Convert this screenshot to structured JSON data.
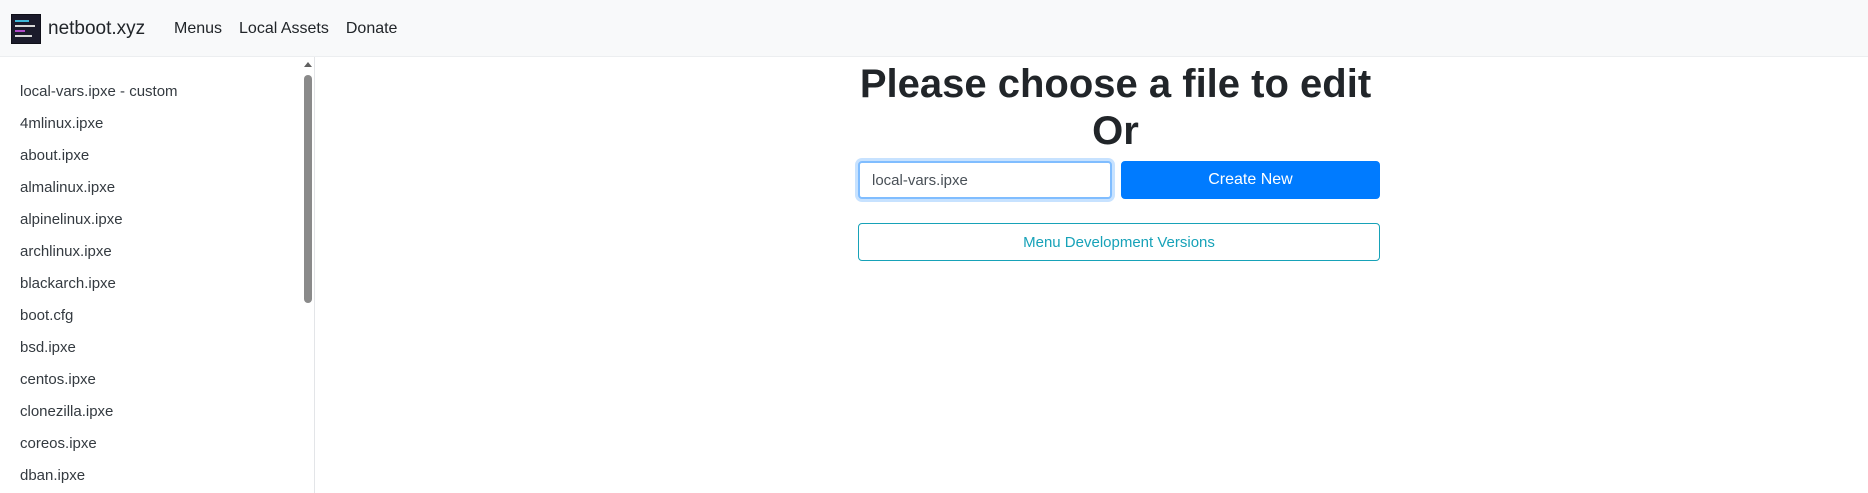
{
  "navbar": {
    "brand": "netboot.xyz",
    "links": [
      "Menus",
      "Local Assets",
      "Donate"
    ]
  },
  "sidebar": {
    "files": [
      "local-vars.ipxe - custom",
      "4mlinux.ipxe",
      "about.ipxe",
      "almalinux.ipxe",
      "alpinelinux.ipxe",
      "archlinux.ipxe",
      "blackarch.ipxe",
      "boot.cfg",
      "bsd.ipxe",
      "centos.ipxe",
      "clonezilla.ipxe",
      "coreos.ipxe",
      "dban.ipxe"
    ]
  },
  "main": {
    "heading": "Please choose a file to edit",
    "or_text": "Or",
    "filename_input": {
      "value": "local-vars.ipxe"
    },
    "create_button": "Create New",
    "dev_versions_button": "Menu Development Versions"
  },
  "colors": {
    "primary": "#007bff",
    "info": "#17a2b8",
    "navbar_bg": "#f8f9fa",
    "text": "#212529"
  }
}
